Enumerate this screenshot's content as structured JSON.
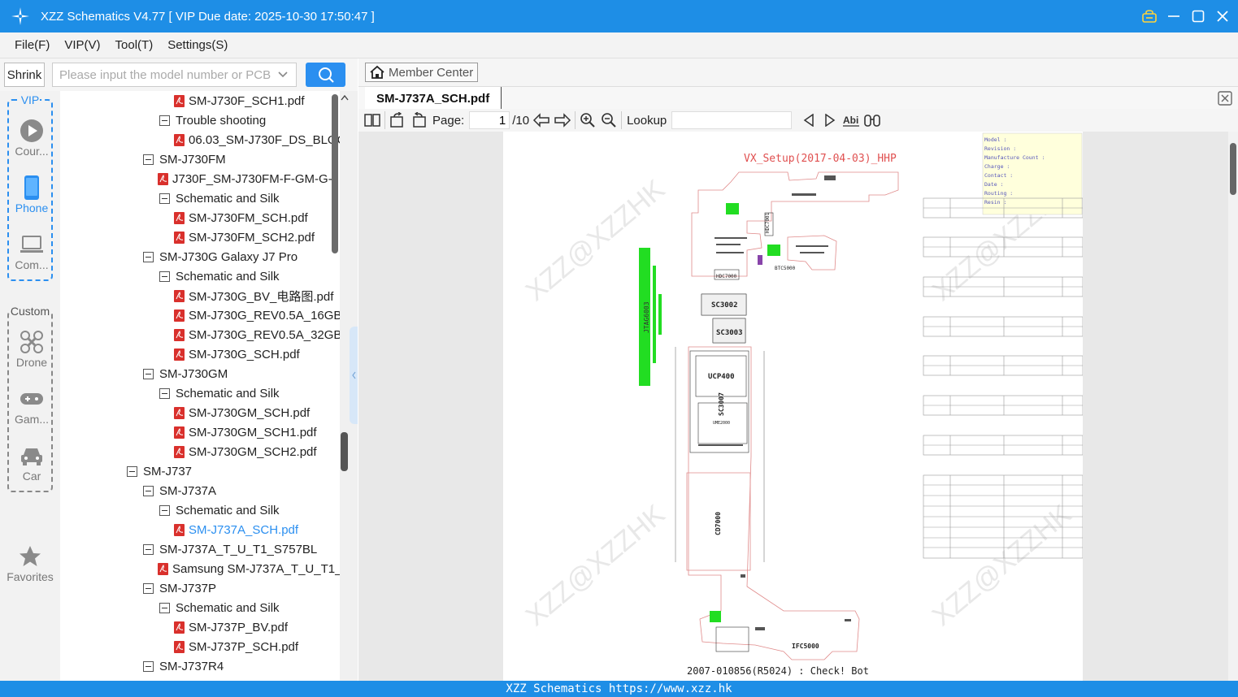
{
  "window": {
    "title": "XZZ Schematics V4.77 [ VIP Due date: 2025-10-30 17:50:47 ]"
  },
  "menu": [
    "File(F)",
    "VIP(V)",
    "Tool(T)",
    "Settings(S)"
  ],
  "search": {
    "shrink_label": "Shrink",
    "placeholder": "Please input the model number or PCB"
  },
  "categories": {
    "vip_label": "VIP",
    "custom_label": "Custom",
    "vip_items": [
      "Cour...",
      "Phone",
      "Com..."
    ],
    "custom_items": [
      "Drone",
      "Gam...",
      "Car"
    ],
    "favorites": "Favorites"
  },
  "tree": [
    {
      "label": "SM-J730F_SCH1.pdf",
      "type": "pdf",
      "level": 3
    },
    {
      "label": "Trouble shooting",
      "type": "folder",
      "level": 2
    },
    {
      "label": "06.03_SM-J730F_DS_BLOC",
      "type": "pdf",
      "level": 3
    },
    {
      "label": "SM-J730FM",
      "type": "folder",
      "level": 1
    },
    {
      "label": "J730F_SM-J730FM-F-GM-G-I",
      "type": "pdf",
      "level": 2
    },
    {
      "label": "Schematic and Silk",
      "type": "folder",
      "level": 2
    },
    {
      "label": "SM-J730FM_SCH.pdf",
      "type": "pdf",
      "level": 3
    },
    {
      "label": "SM-J730FM_SCH2.pdf",
      "type": "pdf",
      "level": 3
    },
    {
      "label": "SM-J730G Galaxy J7 Pro",
      "type": "folder",
      "level": 1
    },
    {
      "label": "Schematic and Silk",
      "type": "folder",
      "level": 2
    },
    {
      "label": "SM-J730G_BV_电路图.pdf",
      "type": "pdf",
      "level": 3
    },
    {
      "label": "SM-J730G_REV0.5A_16GB",
      "type": "pdf",
      "level": 3
    },
    {
      "label": "SM-J730G_REV0.5A_32GB",
      "type": "pdf",
      "level": 3
    },
    {
      "label": "SM-J730G_SCH.pdf",
      "type": "pdf",
      "level": 3
    },
    {
      "label": "SM-J730GM",
      "type": "folder",
      "level": 1
    },
    {
      "label": "Schematic and Silk",
      "type": "folder",
      "level": 2
    },
    {
      "label": "SM-J730GM_SCH.pdf",
      "type": "pdf",
      "level": 3
    },
    {
      "label": "SM-J730GM_SCH1.pdf",
      "type": "pdf",
      "level": 3
    },
    {
      "label": "SM-J730GM_SCH2.pdf",
      "type": "pdf",
      "level": 3
    },
    {
      "label": "SM-J737",
      "type": "folder",
      "level": 0
    },
    {
      "label": "SM-J737A",
      "type": "folder",
      "level": 1
    },
    {
      "label": "Schematic and Silk",
      "type": "folder",
      "level": 2
    },
    {
      "label": "SM-J737A_SCH.pdf",
      "type": "pdf",
      "level": 3,
      "selected": true
    },
    {
      "label": "SM-J737A_T_U_T1_S757BL",
      "type": "folder",
      "level": 1
    },
    {
      "label": "Samsung SM-J737A_T_U_T1_",
      "type": "pdf",
      "level": 2
    },
    {
      "label": "SM-J737P",
      "type": "folder",
      "level": 1
    },
    {
      "label": "Schematic and Silk",
      "type": "folder",
      "level": 2
    },
    {
      "label": "SM-J737P_BV.pdf",
      "type": "pdf",
      "level": 3
    },
    {
      "label": "SM-J737P_SCH.pdf",
      "type": "pdf",
      "level": 3
    },
    {
      "label": "SM-J737R4",
      "type": "folder",
      "level": 1
    }
  ],
  "viewer": {
    "member_center": "Member Center",
    "tab_label": "SM-J737A_SCH.pdf",
    "page_label": "Page:",
    "page_current": "1",
    "page_total": "/10",
    "lookup_label": "Lookup"
  },
  "schematic": {
    "header": "VX_Setup(2017-04-03)_HHP",
    "footer": "2007-010856(R5024) : Check!  Bot",
    "watermark": "XZZ@XZZHK",
    "info_lines": [
      "Model :",
      "Revision :",
      "Manufacture Count :",
      "Charge :",
      "Contact :",
      "Date :",
      "Routing :",
      "Resin :"
    ],
    "chip_labels": [
      "HDC7001",
      "HDC7000",
      "BTC5000",
      "SC3002",
      "SC3003",
      "UCP400",
      "SC3007",
      "UME2000",
      "CD7000",
      "IFC5000",
      "JTAG6003"
    ]
  },
  "status": {
    "text": "XZZ Schematics https://www.xzz.hk"
  },
  "colors": {
    "primary": "#1e8ee6",
    "accent": "#2b8ff0",
    "pdf_red": "#d9302c",
    "pcb_outline": "#e08a8a",
    "header_red": "#e05050",
    "green": "#22dd22"
  }
}
